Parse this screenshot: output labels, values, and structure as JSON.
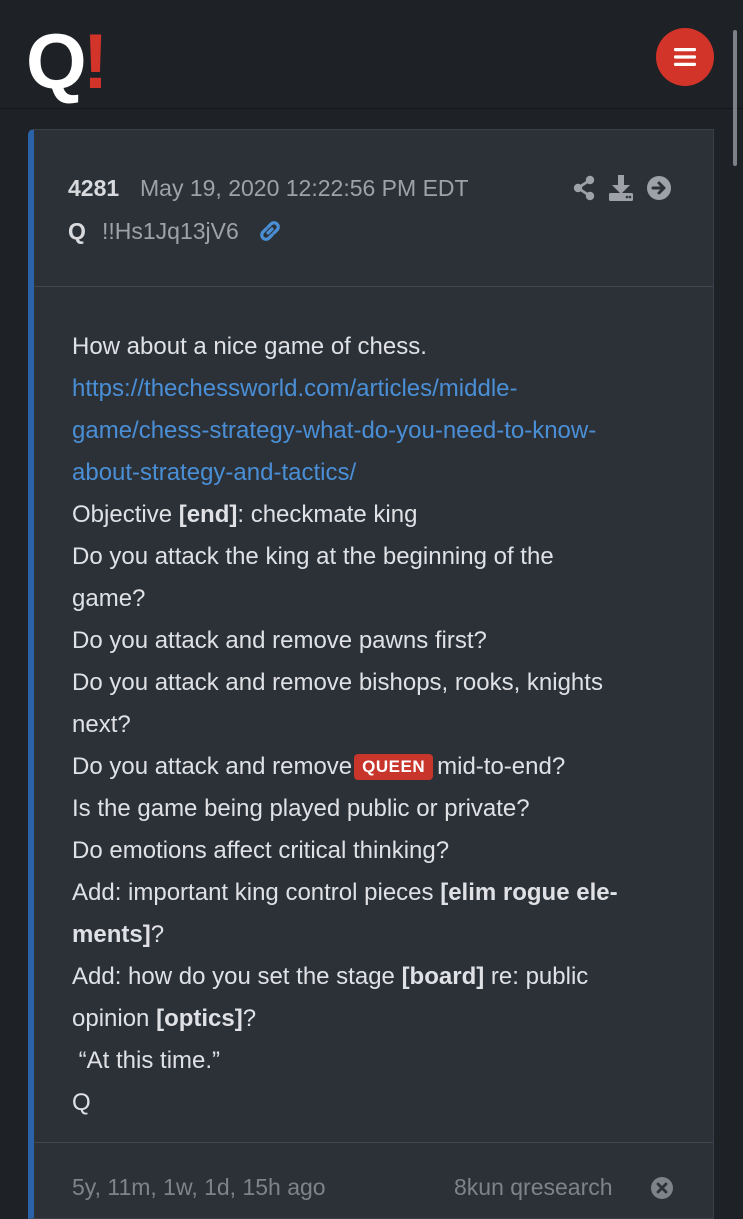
{
  "logo": {
    "letter": "Q",
    "mark": "!"
  },
  "header_icons": {
    "menu": "hamburger-icon",
    "share": "share-icon",
    "download": "download-icon",
    "goto": "arrow-right-circle-icon",
    "link": "link-icon"
  },
  "post": {
    "number": "4281",
    "date": "May 19, 2020 12:22:56 PM EDT",
    "author": "Q",
    "tripcode": "!!Hs1Jq13jV6",
    "lines": {
      "l1": "How about a nice game of chess.",
      "url1": "https://thechessworld.com/articles/middle-",
      "url2": "game/chess-strategy-what-do-you-need-to-know-",
      "url3": "about-strategy-and-tactics/",
      "l5a": "Objective ",
      "l5b": "[end]",
      "l5c": ": checkmate king",
      "l6": "Do you attack the king at the beginning of the",
      "l7": "game?",
      "l8": "Do you attack and remove pawns first?",
      "l9": "Do you attack and remove bishops, rooks, knights",
      "l10": "next?",
      "l11a": "Do you attack and remove",
      "l11tag": "QUEEN",
      "l11b": "mid-to-end?",
      "l12": "Is the game being played public or private?",
      "l13": "Do emotions affect critical thinking?",
      "l14a": "Add: important king control pieces ",
      "l14b": "[elim rogue ele-",
      "l15a": "ments]",
      "l15b": "?",
      "l16a": "Add: how do you set the stage ",
      "l16b": "[board]",
      "l16c": " re: public",
      "l17a": "opinion ",
      "l17b": "[optics]",
      "l17c": "?",
      "l18": " “At this time.”",
      "l19": "Q"
    },
    "footer_age": "5y, 11m, 1w, 1d, 15h ago",
    "footer_source": "8kun qresearch"
  },
  "colors": {
    "accent": "#d3342a",
    "link": "#4a8fd6",
    "post_border": "#2c62a8",
    "background": "#1e2126",
    "post_bg": "#2c3138"
  }
}
